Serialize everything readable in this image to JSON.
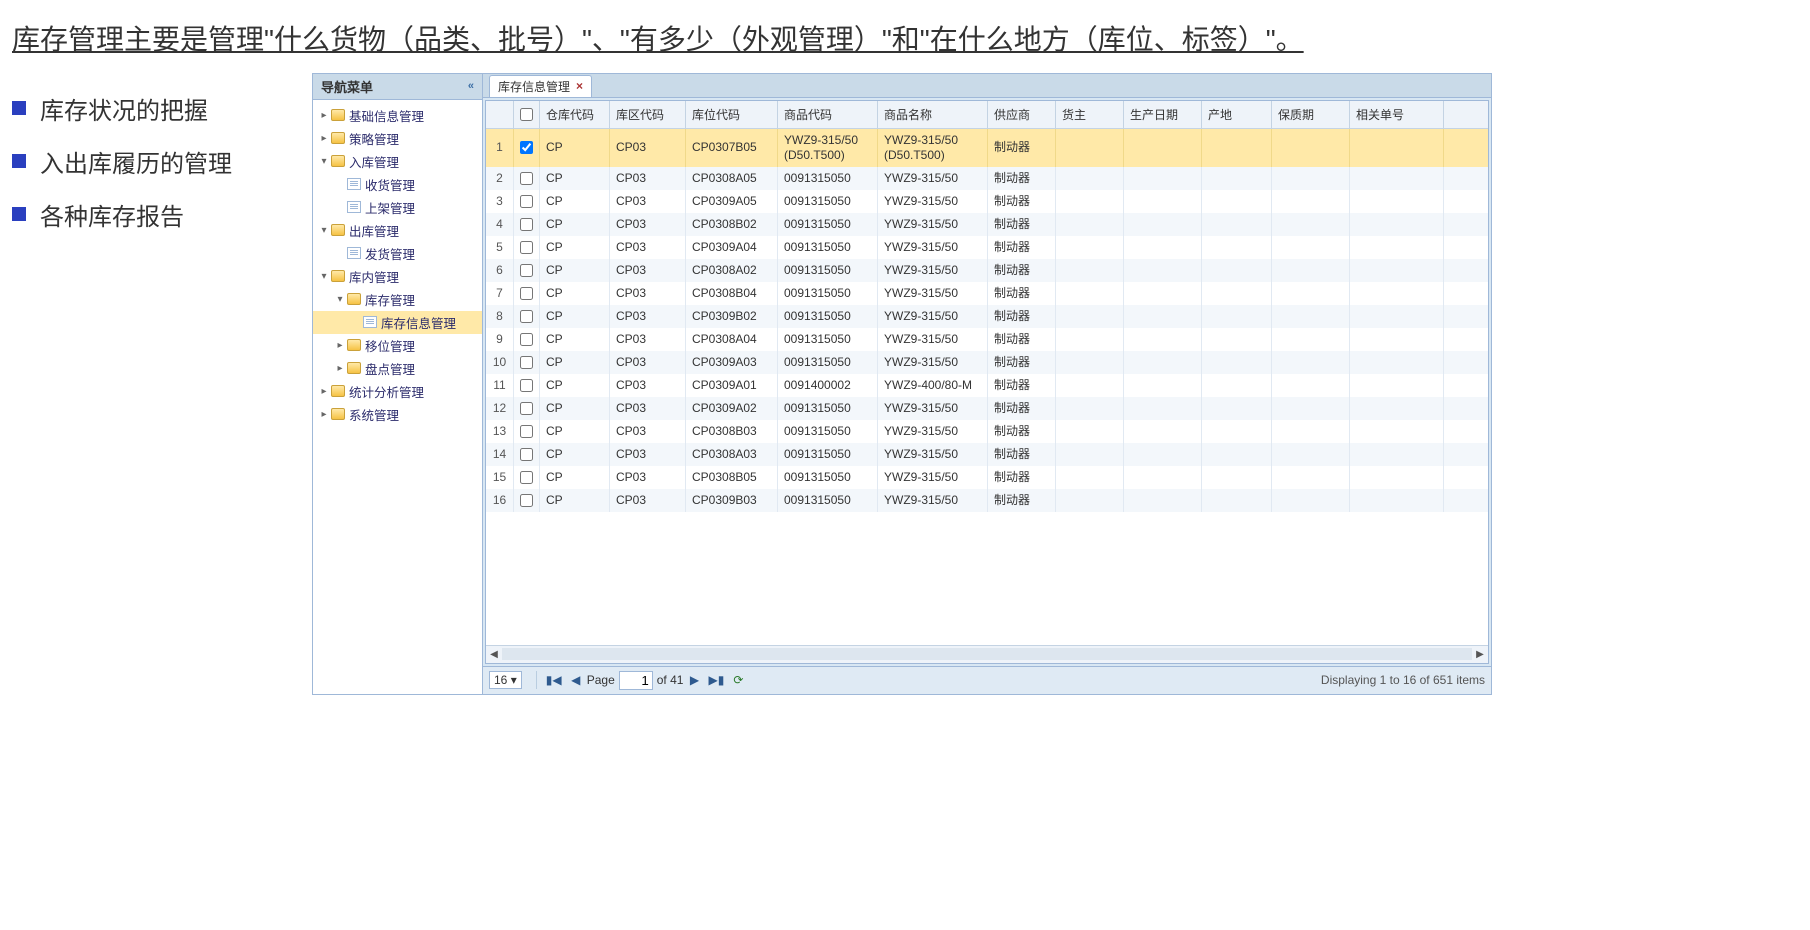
{
  "headline": "库存管理主要是管理\"什么货物（品类、批号）\"、\"有多少（外观管理）\"和\"在什么地方（库位、标签）\"。",
  "bullets": [
    "库存状况的把握",
    "入出库履历的管理",
    "各种库存报告"
  ],
  "nav": {
    "title": "导航菜单",
    "items": [
      {
        "exp": "▸",
        "type": "folder",
        "label": "基础信息管理",
        "depth": 0
      },
      {
        "exp": "▸",
        "type": "folder",
        "label": "策略管理",
        "depth": 0
      },
      {
        "exp": "▾",
        "type": "folder",
        "label": "入库管理",
        "depth": 0
      },
      {
        "exp": "",
        "type": "page",
        "label": "收货管理",
        "depth": 1
      },
      {
        "exp": "",
        "type": "page",
        "label": "上架管理",
        "depth": 1
      },
      {
        "exp": "▾",
        "type": "folder",
        "label": "出库管理",
        "depth": 0
      },
      {
        "exp": "",
        "type": "page",
        "label": "发货管理",
        "depth": 1
      },
      {
        "exp": "▾",
        "type": "folder",
        "label": "库内管理",
        "depth": 0
      },
      {
        "exp": "▾",
        "type": "folder",
        "label": "库存管理",
        "depth": 1
      },
      {
        "exp": "",
        "type": "page",
        "label": "库存信息管理",
        "depth": 2,
        "selected": true
      },
      {
        "exp": "▸",
        "type": "folder",
        "label": "移位管理",
        "depth": 1
      },
      {
        "exp": "▸",
        "type": "folder",
        "label": "盘点管理",
        "depth": 1
      },
      {
        "exp": "▸",
        "type": "folder",
        "label": "统计分析管理",
        "depth": 0
      },
      {
        "exp": "▸",
        "type": "folder",
        "label": "系统管理",
        "depth": 0
      }
    ]
  },
  "tab": {
    "label": "库存信息管理"
  },
  "grid": {
    "columns": [
      "仓库代码",
      "库区代码",
      "库位代码",
      "商品代码",
      "商品名称",
      "供应商",
      "货主",
      "生产日期",
      "产地",
      "保质期",
      "相关单号"
    ],
    "rows": [
      {
        "n": 1,
        "chk": true,
        "selected": true,
        "c": [
          "CP",
          "CP03",
          "CP0307B05",
          "YWZ9-315/50 (D50.T500)",
          "YWZ9-315/50 (D50.T500)",
          "制动器",
          "",
          "",
          "",
          "",
          ""
        ]
      },
      {
        "n": 2,
        "c": [
          "CP",
          "CP03",
          "CP0308A05",
          "0091315050",
          "YWZ9-315/50",
          "制动器",
          "",
          "",
          "",
          "",
          ""
        ]
      },
      {
        "n": 3,
        "c": [
          "CP",
          "CP03",
          "CP0309A05",
          "0091315050",
          "YWZ9-315/50",
          "制动器",
          "",
          "",
          "",
          "",
          ""
        ]
      },
      {
        "n": 4,
        "c": [
          "CP",
          "CP03",
          "CP0308B02",
          "0091315050",
          "YWZ9-315/50",
          "制动器",
          "",
          "",
          "",
          "",
          ""
        ]
      },
      {
        "n": 5,
        "c": [
          "CP",
          "CP03",
          "CP0309A04",
          "0091315050",
          "YWZ9-315/50",
          "制动器",
          "",
          "",
          "",
          "",
          ""
        ]
      },
      {
        "n": 6,
        "c": [
          "CP",
          "CP03",
          "CP0308A02",
          "0091315050",
          "YWZ9-315/50",
          "制动器",
          "",
          "",
          "",
          "",
          ""
        ]
      },
      {
        "n": 7,
        "c": [
          "CP",
          "CP03",
          "CP0308B04",
          "0091315050",
          "YWZ9-315/50",
          "制动器",
          "",
          "",
          "",
          "",
          ""
        ]
      },
      {
        "n": 8,
        "c": [
          "CP",
          "CP03",
          "CP0309B02",
          "0091315050",
          "YWZ9-315/50",
          "制动器",
          "",
          "",
          "",
          "",
          ""
        ]
      },
      {
        "n": 9,
        "c": [
          "CP",
          "CP03",
          "CP0308A04",
          "0091315050",
          "YWZ9-315/50",
          "制动器",
          "",
          "",
          "",
          "",
          ""
        ]
      },
      {
        "n": 10,
        "c": [
          "CP",
          "CP03",
          "CP0309A03",
          "0091315050",
          "YWZ9-315/50",
          "制动器",
          "",
          "",
          "",
          "",
          ""
        ]
      },
      {
        "n": 11,
        "c": [
          "CP",
          "CP03",
          "CP0309A01",
          "0091400002",
          "YWZ9-400/80-M",
          "制动器",
          "",
          "",
          "",
          "",
          ""
        ]
      },
      {
        "n": 12,
        "c": [
          "CP",
          "CP03",
          "CP0309A02",
          "0091315050",
          "YWZ9-315/50",
          "制动器",
          "",
          "",
          "",
          "",
          ""
        ]
      },
      {
        "n": 13,
        "c": [
          "CP",
          "CP03",
          "CP0308B03",
          "0091315050",
          "YWZ9-315/50",
          "制动器",
          "",
          "",
          "",
          "",
          ""
        ]
      },
      {
        "n": 14,
        "c": [
          "CP",
          "CP03",
          "CP0308A03",
          "0091315050",
          "YWZ9-315/50",
          "制动器",
          "",
          "",
          "",
          "",
          ""
        ]
      },
      {
        "n": 15,
        "c": [
          "CP",
          "CP03",
          "CP0308B05",
          "0091315050",
          "YWZ9-315/50",
          "制动器",
          "",
          "",
          "",
          "",
          ""
        ]
      },
      {
        "n": 16,
        "c": [
          "CP",
          "CP03",
          "CP0309B03",
          "0091315050",
          "YWZ9-315/50",
          "制动器",
          "",
          "",
          "",
          "",
          ""
        ]
      }
    ]
  },
  "pager": {
    "pageSize": "16",
    "pageLabel": "Page",
    "page": "1",
    "ofLabel": "of 41",
    "info": "Displaying 1 to 16 of 651 items"
  }
}
